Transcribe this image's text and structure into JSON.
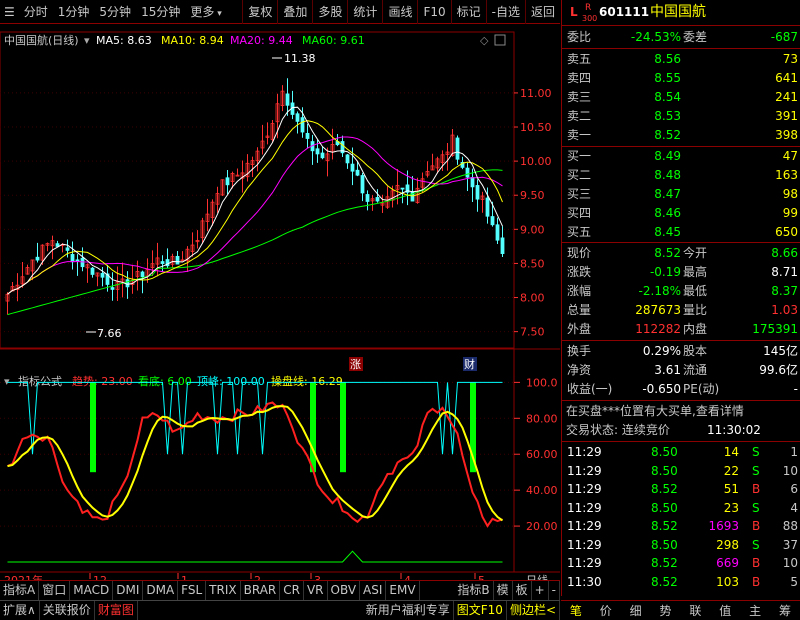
{
  "toolbar": {
    "left": [
      "分时",
      "1分钟",
      "5分钟",
      "15分钟",
      "更多"
    ],
    "right": [
      "复权",
      "叠加",
      "多股",
      "统计",
      "画线",
      "F10",
      "标记",
      "-自选",
      "返回"
    ]
  },
  "chart": {
    "title": "中国国航(日线)",
    "ma": [
      {
        "label": "MA5: 8.63",
        "color": "#ffffff"
      },
      {
        "label": "MA10: 8.94",
        "color": "#ffff00"
      },
      {
        "label": "MA20: 9.44",
        "color": "#ff00ff"
      },
      {
        "label": "MA60: 9.61",
        "color": "#00ff00"
      }
    ],
    "price_ticks": [
      "11.00",
      "10.50",
      "10.00",
      "9.50",
      "9.00",
      "8.50",
      "8.00",
      "7.50"
    ],
    "high_label": "11.38",
    "low_label": "7.66",
    "marker_up": "涨",
    "marker_fin": "财"
  },
  "indicator": {
    "name": "指标公式",
    "items": [
      {
        "label": "趋势: 23.00",
        "color": "#ff3030"
      },
      {
        "label": "看底: 6.00",
        "color": "#00ff00"
      },
      {
        "label": "顶峰: 100.00",
        "color": "#00ffff"
      },
      {
        "label": "操盘线: 16.29",
        "color": "#ffff00"
      }
    ],
    "ticks": [
      "100.0",
      "80.00",
      "60.00",
      "40.00",
      "20.00"
    ]
  },
  "time_axis": {
    "labels": [
      "2021年",
      "12",
      "1",
      "2",
      "3",
      "4",
      "5"
    ],
    "right_label": "日线"
  },
  "bottom_tabs": [
    "指标A",
    "窗口",
    "MACD",
    "DMI",
    "DMA",
    "FSL",
    "TRIX",
    "BRAR",
    "CR",
    "VR",
    "OBV",
    "ASI",
    "EMV",
    "指标B",
    "模",
    "板",
    "+",
    "-"
  ],
  "bottom2": {
    "left": [
      "扩展∧",
      "关联报价",
      "财富图"
    ],
    "right": [
      "新用户福利专享",
      "图文F10",
      "侧边栏<"
    ]
  },
  "quote": {
    "code": "601111",
    "name": "中国国航",
    "badge_l": "L",
    "badge_r": "R",
    "badge_num": "300",
    "weibi_label": "委比",
    "weibi": "-24.53%",
    "weicha_label": "委差",
    "weicha": "-687",
    "asks": [
      {
        "label": "卖五",
        "price": "8.56",
        "vol": "73"
      },
      {
        "label": "卖四",
        "price": "8.55",
        "vol": "641"
      },
      {
        "label": "卖三",
        "price": "8.54",
        "vol": "241"
      },
      {
        "label": "卖二",
        "price": "8.53",
        "vol": "391"
      },
      {
        "label": "卖一",
        "price": "8.52",
        "vol": "398"
      }
    ],
    "bids": [
      {
        "label": "买一",
        "price": "8.49",
        "vol": "47"
      },
      {
        "label": "买二",
        "price": "8.48",
        "vol": "163"
      },
      {
        "label": "买三",
        "price": "8.47",
        "vol": "98"
      },
      {
        "label": "买四",
        "price": "8.46",
        "vol": "99"
      },
      {
        "label": "买五",
        "price": "8.45",
        "vol": "650"
      }
    ],
    "stats": [
      {
        "l1": "现价",
        "v1": "8.52",
        "c1": "#00ff00",
        "l2": "今开",
        "v2": "8.66",
        "c2": "#00ff00"
      },
      {
        "l1": "涨跌",
        "v1": "-0.19",
        "c1": "#00ff00",
        "l2": "最高",
        "v2": "8.71",
        "c2": "#ffffff"
      },
      {
        "l1": "涨幅",
        "v1": "-2.18%",
        "c1": "#00ff00",
        "l2": "最低",
        "v2": "8.37",
        "c2": "#00ff00"
      },
      {
        "l1": "总量",
        "v1": "287673",
        "c1": "#ffff00",
        "l2": "量比",
        "v2": "1.03",
        "c2": "#ff3030"
      },
      {
        "l1": "外盘",
        "v1": "112282",
        "c1": "#ff3030",
        "l2": "内盘",
        "v2": "175391",
        "c2": "#00ff00"
      }
    ],
    "stats2": [
      {
        "l1": "换手",
        "v1": "0.29%",
        "l2": "股本",
        "v2": "145亿"
      },
      {
        "l1": "净资",
        "v1": "3.61",
        "l2": "流通",
        "v2": "99.6亿"
      },
      {
        "l1": "收益(一)",
        "v1": "-0.650",
        "l2": "PE(动)",
        "v2": "-"
      }
    ],
    "notice": "在买盘***位置有大买单,查看详情",
    "status_label": "交易状态: 连续竞价",
    "status_time": "11:30:02",
    "trades": [
      {
        "t": "11:29",
        "p": "8.50",
        "v": "14",
        "bs": "S",
        "n": "1",
        "vc": "#ffff00",
        "bc": "#00ff00"
      },
      {
        "t": "11:29",
        "p": "8.50",
        "v": "22",
        "bs": "S",
        "n": "10",
        "vc": "#ffff00",
        "bc": "#00ff00"
      },
      {
        "t": "11:29",
        "p": "8.52",
        "v": "51",
        "bs": "B",
        "n": "6",
        "vc": "#ffff00",
        "bc": "#ff3030"
      },
      {
        "t": "11:29",
        "p": "8.50",
        "v": "23",
        "bs": "S",
        "n": "4",
        "vc": "#ffff00",
        "bc": "#00ff00"
      },
      {
        "t": "11:29",
        "p": "8.52",
        "v": "1693",
        "bs": "B",
        "n": "88",
        "vc": "#ff00ff",
        "bc": "#ff3030"
      },
      {
        "t": "11:29",
        "p": "8.50",
        "v": "298",
        "bs": "S",
        "n": "37",
        "vc": "#ffff00",
        "bc": "#00ff00"
      },
      {
        "t": "11:29",
        "p": "8.52",
        "v": "669",
        "bs": "B",
        "n": "10",
        "vc": "#ff00ff",
        "bc": "#ff3030"
      },
      {
        "t": "11:30",
        "p": "8.52",
        "v": "103",
        "bs": "B",
        "n": "5",
        "vc": "#ffff00",
        "bc": "#ff3030"
      }
    ]
  },
  "right_bottom": [
    "笔",
    "价",
    "细",
    "势",
    "联",
    "值",
    "主",
    "筹"
  ],
  "colors": {
    "frame": "#8b0000",
    "up": "#ff3030",
    "down": "#00ff00",
    "accent": "#ffff00"
  }
}
